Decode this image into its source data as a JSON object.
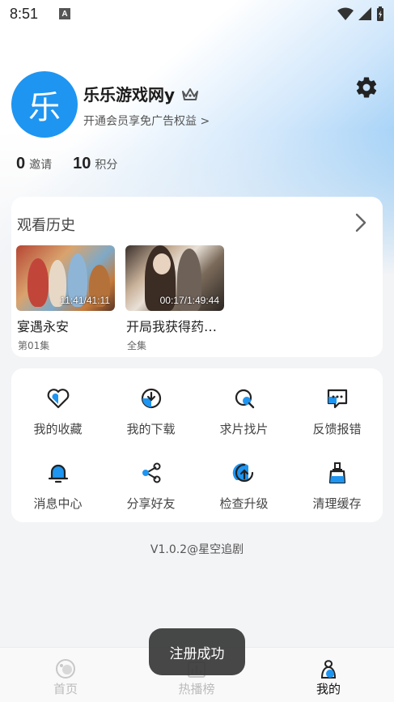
{
  "status_bar": {
    "time": "8:51",
    "notif_icon": "A"
  },
  "profile": {
    "avatar_char": "乐",
    "username": "乐乐游戏网y",
    "vip_text": "开通会员享免广告权益 >"
  },
  "stats": {
    "invites_value": "0",
    "invites_label": "邀请",
    "points_value": "10",
    "points_label": "积分"
  },
  "history": {
    "title": "观看历史",
    "items": [
      {
        "title": "宴遇永安",
        "subtitle": "第01集",
        "duration": "11:41/41:11"
      },
      {
        "title": "开局我获得药…",
        "subtitle": "全集",
        "duration": "00:17/1:49:44"
      }
    ]
  },
  "grid": {
    "items": [
      {
        "label": "我的收藏",
        "icon": "heart-icon"
      },
      {
        "label": "我的下载",
        "icon": "download-icon"
      },
      {
        "label": "求片找片",
        "icon": "search-film-icon"
      },
      {
        "label": "反馈报错",
        "icon": "feedback-icon"
      },
      {
        "label": "消息中心",
        "icon": "bell-icon"
      },
      {
        "label": "分享好友",
        "icon": "share-icon"
      },
      {
        "label": "检查升级",
        "icon": "upgrade-icon"
      },
      {
        "label": "清理缓存",
        "icon": "clean-icon"
      }
    ]
  },
  "version": "V1.0.2@星空追剧",
  "tabs": [
    {
      "label": "首页",
      "icon": "home-icon"
    },
    {
      "label": "热播榜",
      "icon": "ranking-icon"
    },
    {
      "label": "我的",
      "icon": "profile-icon"
    }
  ],
  "toast": "注册成功",
  "colors": {
    "accent": "#1e95f1",
    "background": "#f3f4f6"
  }
}
